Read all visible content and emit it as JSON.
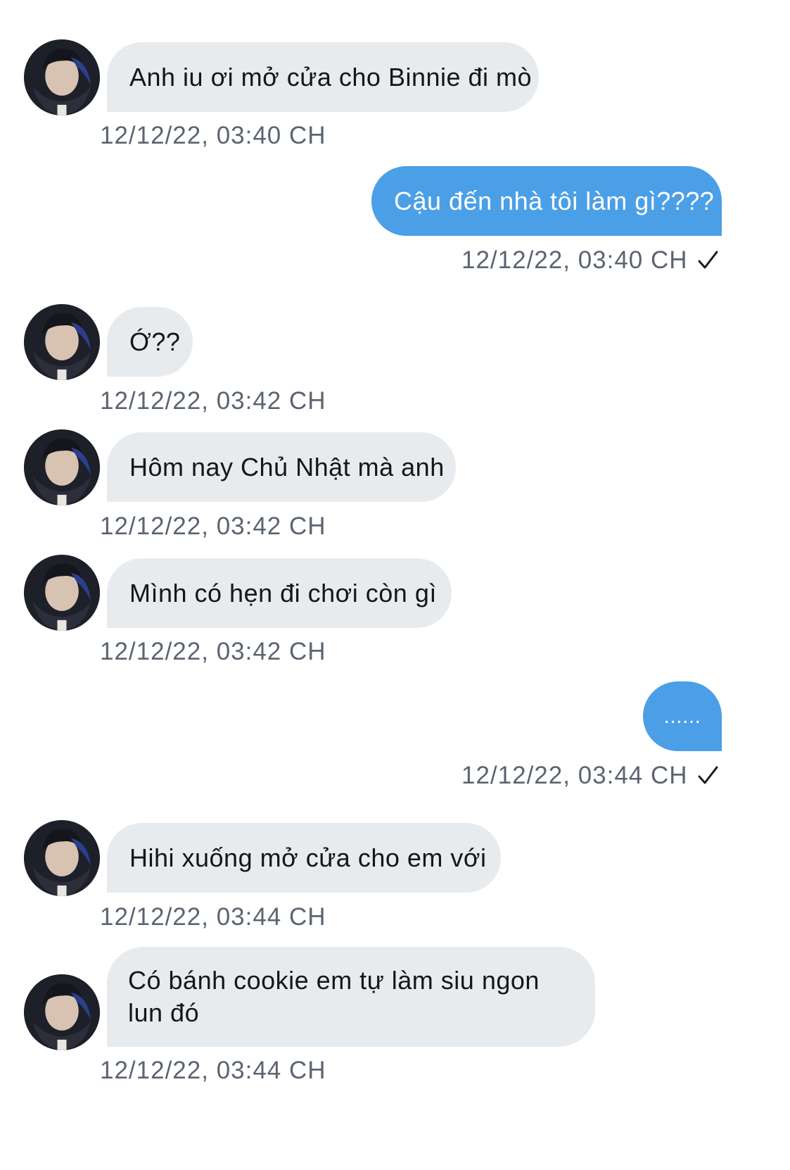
{
  "messages": [
    {
      "text": "Anh iu ơi mở cửa cho Binnie đi mò",
      "time": "12/12/22, 03:40 CH"
    },
    {
      "text": "Cậu đến nhà tôi làm gì????",
      "time": "12/12/22, 03:40 CH"
    },
    {
      "text": "Ớ??",
      "time": "12/12/22, 03:42 CH"
    },
    {
      "text": "Hôm nay Chủ Nhật mà anh",
      "time": "12/12/22, 03:42 CH"
    },
    {
      "text": "Mình có hẹn đi chơi còn gì",
      "time": "12/12/22, 03:42 CH"
    },
    {
      "text": "......",
      "time": "12/12/22, 03:44 CH"
    },
    {
      "text": "Hihi xuống mở cửa cho em với",
      "time": "12/12/22, 03:44 CH"
    },
    {
      "text": "Có bánh cookie em tự làm siu ngon lun đó",
      "time": "12/12/22, 03:44 CH"
    }
  ],
  "colors": {
    "incoming_bubble": "#e8ebee",
    "outgoing_bubble": "#4b9fe6",
    "timestamp": "#5b6470"
  },
  "icons": {
    "read_receipt": "check-icon",
    "contact_photo": "avatar"
  }
}
